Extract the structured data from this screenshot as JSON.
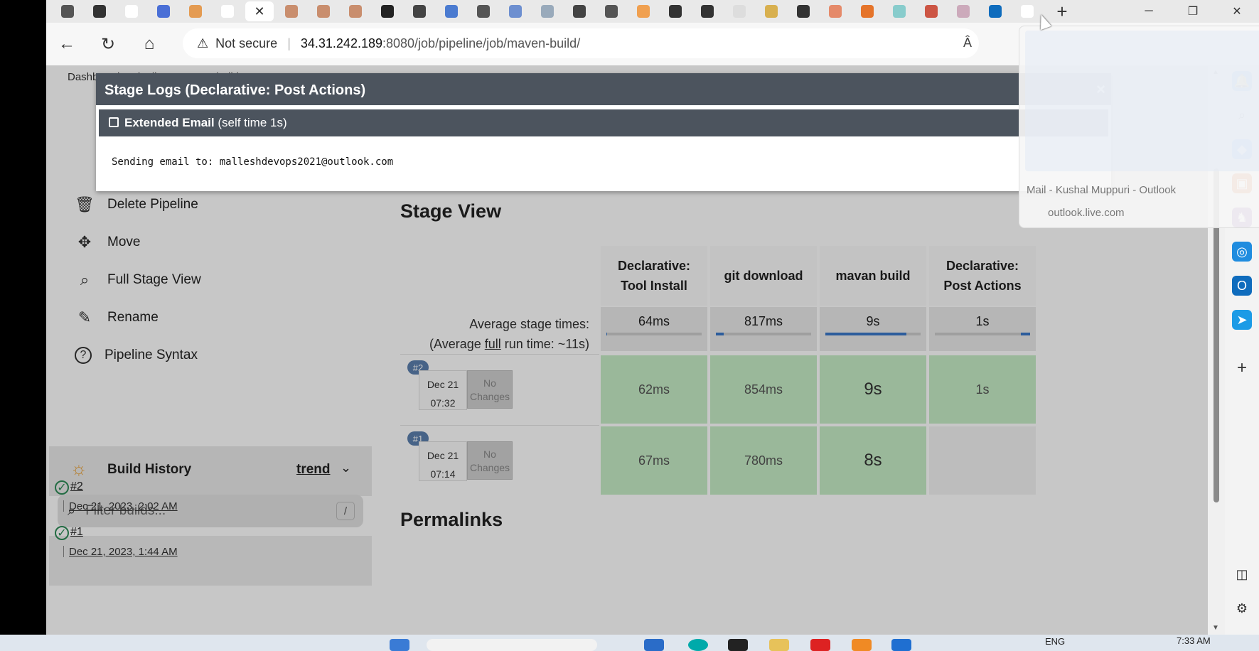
{
  "browser": {
    "tabs_count": 31,
    "active_tab_close": "✕",
    "new_tab": "+",
    "window_controls": [
      "─",
      "❐",
      "✕"
    ],
    "address": {
      "warning_icon": "warning-triangle-icon",
      "not_secure": "Not secure",
      "separator": "|",
      "host": "34.31.242.189",
      "path": ":8080/job/pipeline/job/maven-build/"
    },
    "read_aloud": "Â"
  },
  "breadcrumb": "Dashboard > pipeline > maven-build >",
  "sidebar": {
    "items": [
      {
        "label": "Delete Pipeline",
        "icon": "trash-icon",
        "glyph": "🗑"
      },
      {
        "label": "Move",
        "icon": "move-icon",
        "glyph": "✥"
      },
      {
        "label": "Full Stage View",
        "icon": "search-icon",
        "glyph": "⌕"
      },
      {
        "label": "Rename",
        "icon": "pencil-icon",
        "glyph": "✎"
      },
      {
        "label": "Pipeline Syntax",
        "icon": "help-icon",
        "glyph": "?"
      }
    ],
    "build_history": {
      "title": "Build History",
      "trend": "trend",
      "filter_placeholder": "Filter builds...",
      "filter_shortcut": "/",
      "builds": [
        {
          "number": "#2",
          "date": "Dec 21, 2023, 2:02 AM"
        },
        {
          "number": "#1",
          "date": "Dec 21, 2023, 1:44 AM"
        }
      ]
    }
  },
  "stage_view": {
    "title": "Stage View",
    "avg_label_1": "Average stage times:",
    "avg_label_2a": "(Average ",
    "avg_label_2b": "full",
    "avg_label_2c": " run time: ~11s)",
    "stages": [
      {
        "line1": "Declarative:",
        "line2": "Tool Install",
        "avg": "64ms",
        "avg_fraction": 0.01
      },
      {
        "line1": "git download",
        "line2": "",
        "avg": "817ms",
        "avg_fraction": 0.08
      },
      {
        "line1": "mavan build",
        "line2": "",
        "avg": "9s",
        "avg_fraction": 0.85
      },
      {
        "line1": "Declarative:",
        "line2": "Post Actions",
        "avg": "1s",
        "avg_fraction": 0.1
      }
    ],
    "runs": [
      {
        "num": "#2",
        "date": "Dec 21",
        "time": "07:32",
        "changes_1": "No",
        "changes_2": "Changes",
        "cells": [
          "62ms",
          "854ms",
          "9s",
          "1s"
        ]
      },
      {
        "num": "#1",
        "date": "Dec 21",
        "time": "07:14",
        "changes_1": "No",
        "changes_2": "Changes",
        "cells": [
          "67ms",
          "780ms",
          "8s",
          ""
        ]
      }
    ]
  },
  "permalinks": "Permalinks",
  "modal": {
    "title": "Stage Logs (Declarative: Post Actions)",
    "close": "×",
    "step_name": "Extended Email",
    "step_meta": "(self time 1s)",
    "log": "Sending email to: malleshdevops2021@outlook.com"
  },
  "tab_preview": {
    "title": "Mail - Kushal Muppuri - Outlook",
    "url": "outlook.live.com"
  },
  "taskbar": {
    "lang": "ENG",
    "time": "7:33 AM"
  },
  "colors": {
    "modal_header": "#4c545e",
    "stage_success": "#c6ecc6",
    "run_badge": "#5b7fad",
    "progress": "#3a78c8"
  }
}
